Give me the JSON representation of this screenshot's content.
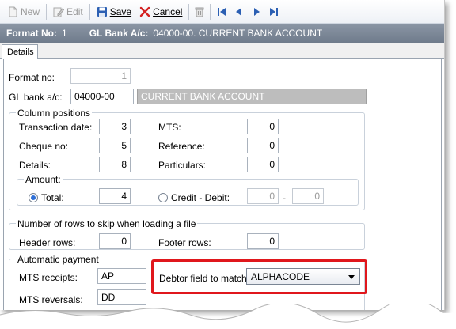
{
  "toolbar": {
    "new_label": "New",
    "edit_label": "Edit",
    "save_label": "Save",
    "cancel_label": "Cancel"
  },
  "infobar": {
    "format_label": "Format No:",
    "format_value": "1",
    "gl_label": "GL Bank A/c:",
    "gl_value": "04000-00. CURRENT BANK ACCOUNT"
  },
  "tabs": [
    "Details"
  ],
  "form": {
    "format_no_label": "Format no:",
    "format_no_value": "1",
    "gl_bank_label": "GL bank a/c:",
    "gl_bank_code": "04000-00",
    "gl_bank_name": "CURRENT BANK ACCOUNT"
  },
  "column_positions": {
    "title": "Column positions",
    "transaction_date_label": "Transaction date:",
    "transaction_date_value": "3",
    "cheque_no_label": "Cheque no:",
    "cheque_no_value": "5",
    "details_label": "Details:",
    "details_value": "8",
    "mts_label": "MTS:",
    "mts_value": "0",
    "reference_label": "Reference:",
    "reference_value": "0",
    "particulars_label": "Particulars:",
    "particulars_value": "0",
    "amount": {
      "title": "Amount:",
      "total_label": "Total:",
      "total_value": "4",
      "total_selected": true,
      "credit_debit_label": "Credit - Debit:",
      "credit_value": "0",
      "debit_value": "0",
      "separator": "-"
    }
  },
  "skip_rows": {
    "title": "Number of rows to skip when loading a file",
    "header_label": "Header rows:",
    "header_value": "0",
    "footer_label": "Footer rows:",
    "footer_value": "0"
  },
  "automatic_payment": {
    "title": "Automatic payment",
    "mts_receipts_label": "MTS receipts:",
    "mts_receipts_value": "AP",
    "mts_reversals_label": "MTS reversals:",
    "mts_reversals_value": "DD",
    "debtor_field_label": "Debtor field to match:",
    "debtor_field_value": "ALPHACODE"
  },
  "colors": {
    "highlight": "#e0171c",
    "infobar": "#7a8595",
    "radio_accent": "#2f6fd6"
  }
}
